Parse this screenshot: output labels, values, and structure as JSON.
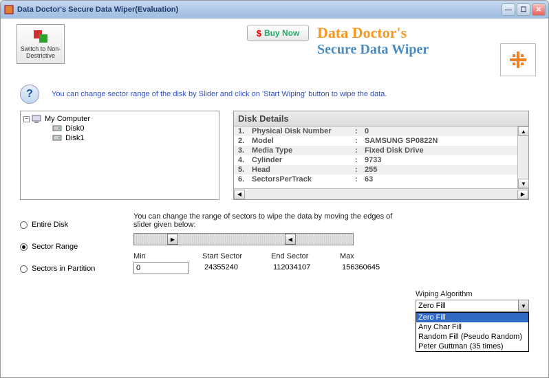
{
  "window": {
    "title": "Data Doctor's Secure Data Wiper(Evaluation)"
  },
  "header": {
    "switch_label": "Switch to\nNon-Destrictive",
    "buynow_label": "Buy Now",
    "brand_line1": "Data Doctor's",
    "brand_line2": "Secure Data Wiper"
  },
  "info": {
    "text": "You can change sector range of the disk by Slider and click on 'Start Wiping' button to wipe the data."
  },
  "tree": {
    "root": "My Computer",
    "children": [
      "Disk0",
      "Disk1"
    ]
  },
  "disk_details": {
    "header": "Disk Details",
    "rows": [
      {
        "num": "1.",
        "label": "Physical Disk Number",
        "value": "0"
      },
      {
        "num": "2.",
        "label": "Model",
        "value": "SAMSUNG SP0822N"
      },
      {
        "num": "3.",
        "label": "Media Type",
        "value": "Fixed Disk Drive"
      },
      {
        "num": "4.",
        "label": "Cylinder",
        "value": "9733"
      },
      {
        "num": "5.",
        "label": "Head",
        "value": "255"
      },
      {
        "num": "6.",
        "label": "SectorsPerTrack",
        "value": "63"
      }
    ]
  },
  "range_options": {
    "entire": "Entire Disk",
    "sector_range": "Sector Range",
    "sectors_partition": "Sectors in Partition"
  },
  "slider": {
    "hint": "You can change the range of sectors to wipe the data by moving the edges of slider given below:",
    "min_label": "Min",
    "start_label": "Start Sector",
    "end_label": "End Sector",
    "max_label": "Max",
    "min_value": "0",
    "start_value": "24355240",
    "end_value": "112034107",
    "max_value": "156360645"
  },
  "algorithm": {
    "label": "Wiping Algorithm",
    "selected": "Zero Fill",
    "options": [
      "Zero Fill",
      "Any Char Fill",
      "Random Fill (Pseudo Random)",
      "Peter Guttman (35 times)"
    ]
  }
}
